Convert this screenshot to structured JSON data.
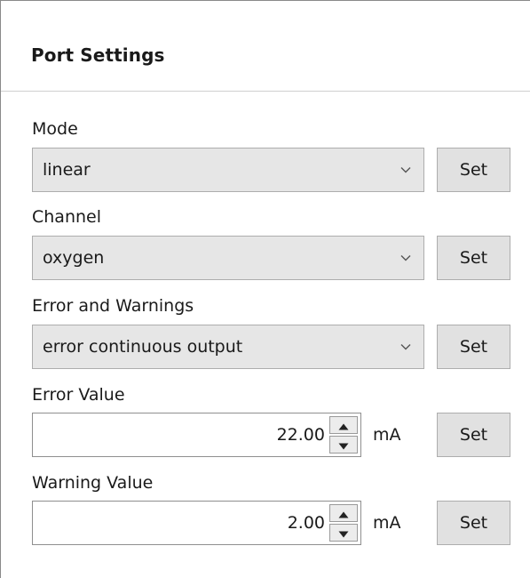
{
  "panel": {
    "title": "Port Settings"
  },
  "fields": {
    "mode": {
      "label": "Mode",
      "value": "linear",
      "set_label": "Set"
    },
    "channel": {
      "label": "Channel",
      "value": "oxygen",
      "set_label": "Set"
    },
    "errors_warnings": {
      "label": "Error and Warnings",
      "value": "error continuous output",
      "set_label": "Set"
    },
    "error_value": {
      "label": "Error Value",
      "value": "22.00",
      "unit": "mA",
      "set_label": "Set"
    },
    "warning_value": {
      "label": "Warning Value",
      "value": "2.00",
      "unit": "mA",
      "set_label": "Set"
    }
  },
  "icons": {
    "dropdown": "chevron-down-icon",
    "spin_up": "arrow-up-icon",
    "spin_down": "arrow-down-icon"
  }
}
